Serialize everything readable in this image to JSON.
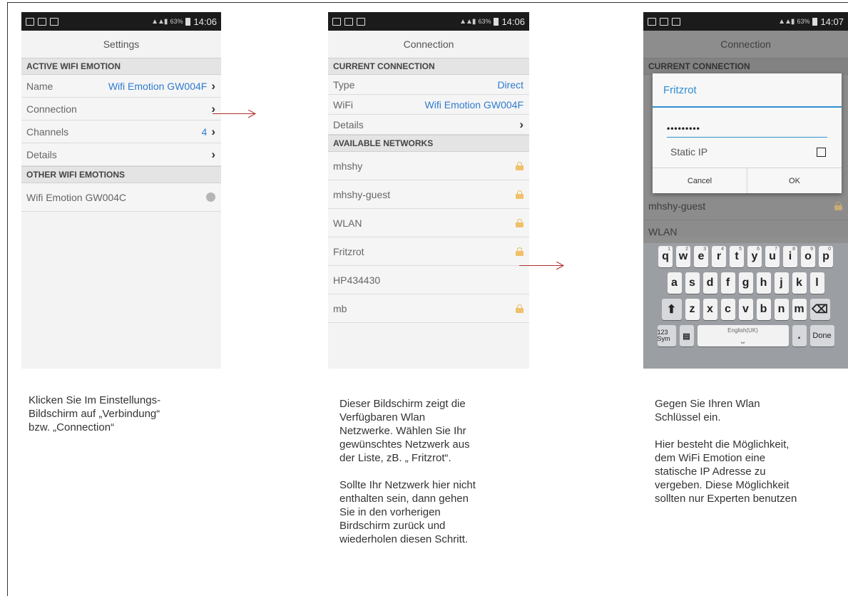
{
  "status_bar": {
    "screen1_time": "14:06",
    "screen2_time": "14:06",
    "screen3_time": "14:07",
    "battery": "63%"
  },
  "screen1": {
    "title": "Settings",
    "section_active": "ACTIVE WIFI EMOTION",
    "rows": [
      {
        "label": "Name",
        "value": "Wifi Emotion GW004F"
      },
      {
        "label": "Connection",
        "value": ""
      },
      {
        "label": "Channels",
        "value": "4"
      },
      {
        "label": "Details",
        "value": ""
      }
    ],
    "section_other": "OTHER WIFI EMOTIONS",
    "other_item": "Wifi Emotion GW004C"
  },
  "screen2": {
    "title": "Connection",
    "section_current": "CURRENT CONNECTION",
    "current_rows": [
      {
        "label": "Type",
        "value": "Direct"
      },
      {
        "label": "WiFi",
        "value": "Wifi Emotion GW004F"
      },
      {
        "label": "Details",
        "value": ""
      }
    ],
    "section_available": "AVAILABLE NETWORKS",
    "networks": [
      {
        "name": "mhshy",
        "locked": true
      },
      {
        "name": "mhshy-guest",
        "locked": true
      },
      {
        "name": "WLAN",
        "locked": true
      },
      {
        "name": "Fritzrot",
        "locked": true
      },
      {
        "name": "HP434430",
        "locked": false
      },
      {
        "name": "mb",
        "locked": true
      }
    ]
  },
  "screen3": {
    "bg_title": "Connection",
    "bg_section": "CURRENT CONNECTION",
    "bg_rows": [
      "mhshy-guest",
      "WLAN"
    ],
    "dialog": {
      "title": "Fritzrot",
      "password_value": "•••••••••",
      "static_ip_label": "Static IP",
      "cancel_label": "Cancel",
      "ok_label": "OK"
    },
    "keyboard": {
      "row1": [
        "q",
        "w",
        "e",
        "r",
        "t",
        "y",
        "u",
        "i",
        "o",
        "p"
      ],
      "row1_sup": [
        "1",
        "2",
        "3",
        "4",
        "5",
        "6",
        "7",
        "8",
        "9",
        "0"
      ],
      "row2": [
        "a",
        "s",
        "d",
        "f",
        "g",
        "h",
        "j",
        "k",
        "l"
      ],
      "row3": [
        "z",
        "x",
        "c",
        "v",
        "b",
        "n",
        "m"
      ],
      "sym_label": "123 Sym",
      "space_label": "English(UK)",
      "period_label": ".",
      "done_label": "Done"
    }
  },
  "captions": {
    "caption1": [
      "Klicken Sie Im Einstellungs-",
      "Bildschirm auf „Verbindung“",
      "bzw. „Connection“"
    ],
    "caption2_p1": [
      "Dieser Bildschirm zeigt die",
      "Verfügbaren Wlan",
      "Netzwerke. Wählen Sie Ihr",
      "gewünschtes Netzwerk aus",
      "der Liste, zB. „ Fritzrot“."
    ],
    "caption2_p2": [
      "Sollte Ihr Netzwerk hier nicht",
      "enthalten sein, dann gehen",
      "Sie in den vorherigen",
      "Birdschirm zurück und",
      "wiederholen diesen Schritt."
    ],
    "caption3_p1": [
      "Gegen Sie Ihren Wlan",
      "Schlüssel ein."
    ],
    "caption3_p2": [
      "Hier besteht die Möglichkeit,",
      "dem WiFi Emotion eine",
      "statische IP Adresse zu",
      "vergeben. Diese Möglichkeit",
      "sollten nur Experten benutzen"
    ]
  },
  "colors": {
    "accent": "#2f7bd0",
    "arrow": "#b0302a",
    "lock": "#f0c06a"
  }
}
